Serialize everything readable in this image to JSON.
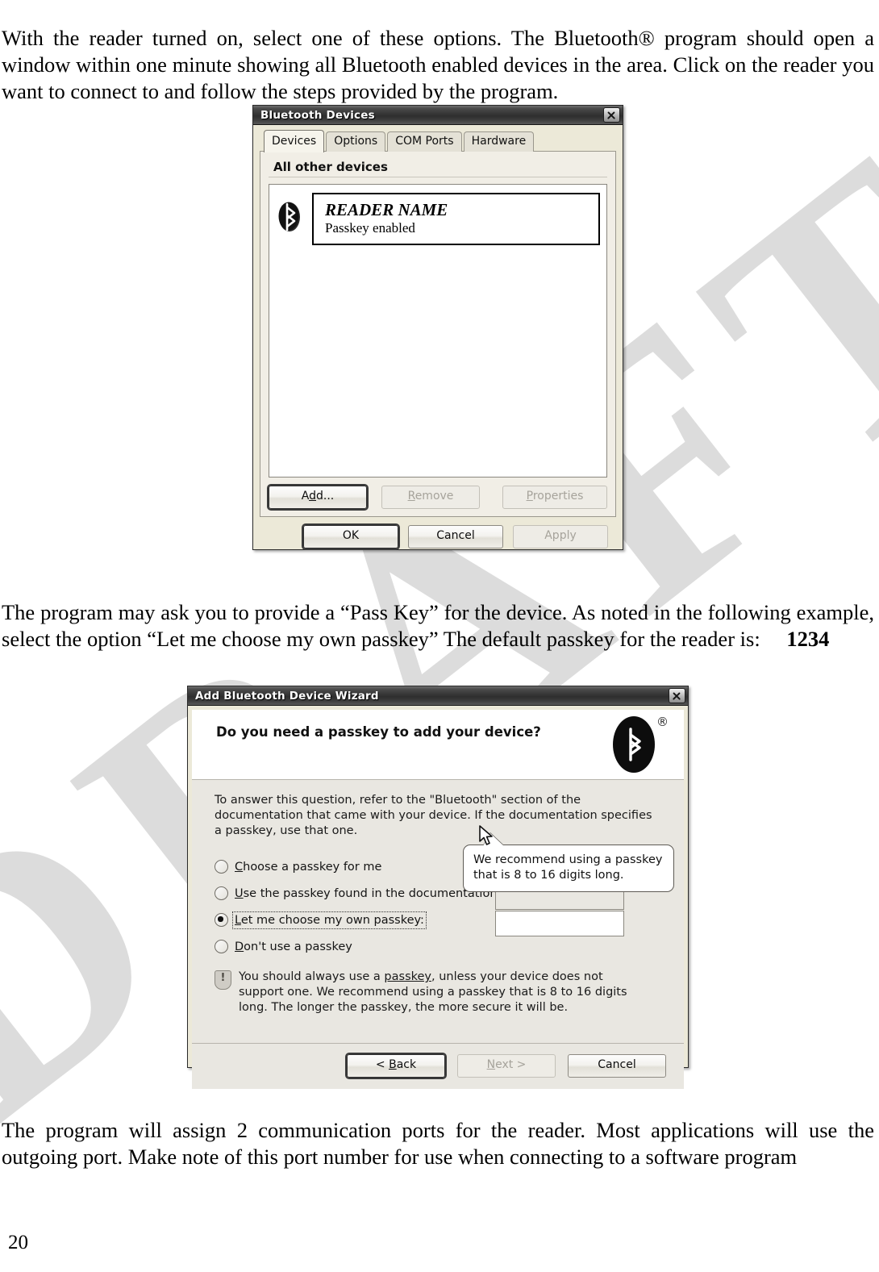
{
  "document": {
    "page_number": "20",
    "watermark": "DRAFT",
    "watermark_color": "#dcdcdc",
    "paragraphs": {
      "intro": "With the reader turned on, select one of these options. The Bluetooth® program should open a window within one minute showing all Bluetooth enabled devices in the area. Click on the reader you want to connect to and follow the steps provided by the program.",
      "passkey_lead": "The program may ask you to provide a “Pass Key” for the device. As noted in the following example, select the option “Let me choose my own passkey” The default passkey for the reader is:",
      "passkey_value": "1234",
      "ports": "The program will assign 2 communication ports for the reader. Most applications will use the outgoing port. Make note of this port number for use when connecting to a software program"
    }
  },
  "bluetooth_devices_dialog": {
    "title": "Bluetooth Devices",
    "close_icon": "close-icon",
    "tabs": [
      {
        "label": "Devices",
        "selected": true
      },
      {
        "label": "Options",
        "selected": false
      },
      {
        "label": "COM Ports",
        "selected": false
      },
      {
        "label": "Hardware",
        "selected": false
      }
    ],
    "group_header": "All other devices",
    "device": {
      "icon": "bluetooth-icon",
      "name": "READER NAME",
      "status": "Passkey enabled"
    },
    "list_buttons": [
      {
        "label": "Add...",
        "enabled": true,
        "focused": true
      },
      {
        "label": "Remove",
        "enabled": false,
        "focused": false
      },
      {
        "label": "Properties",
        "enabled": false,
        "focused": false
      }
    ],
    "footer_buttons": [
      {
        "label": "OK",
        "enabled": true,
        "focused": true
      },
      {
        "label": "Cancel",
        "enabled": true,
        "focused": false
      },
      {
        "label": "Apply",
        "enabled": false,
        "focused": false
      }
    ]
  },
  "add_device_wizard": {
    "title": "Add Bluetooth Device Wizard",
    "close_icon": "close-icon",
    "heading": "Do you need a passkey to add your device?",
    "logo_icon": "bluetooth-logo-icon",
    "registered_mark": "®",
    "instructions": "To answer this question, refer to the \"Bluetooth\" section of the documentation that came with your device. If the documentation specifies a passkey, use that one.",
    "options": [
      {
        "label": "Choose a passkey for me",
        "selected": false,
        "has_field": false,
        "field_value": ""
      },
      {
        "label": "Use the passkey found in the documentation:",
        "selected": false,
        "has_field": true,
        "field_value": "",
        "field_enabled": false
      },
      {
        "label": "Let me choose my own passkey:",
        "selected": true,
        "has_field": true,
        "field_value": "",
        "field_enabled": true
      },
      {
        "label": "Don't use a passkey",
        "selected": false,
        "has_field": false,
        "field_value": ""
      }
    ],
    "note": {
      "icon": "shield-info-icon",
      "text_before_link": "You should always use a ",
      "link_text": "passkey",
      "text_after_link": ", unless your device does not support one. We recommend using a passkey that is 8 to 16 digits long. The longer the passkey, the more secure it will be."
    },
    "tooltip": {
      "text": "We recommend using a passkey that is 8 to 16 digits long."
    },
    "cursor_icon": "mouse-pointer-icon",
    "footer_buttons": [
      {
        "label": "< Back",
        "enabled": true,
        "focused": true
      },
      {
        "label": "Next >",
        "enabled": false,
        "focused": false
      },
      {
        "label": "Cancel",
        "enabled": true,
        "focused": false
      }
    ]
  }
}
